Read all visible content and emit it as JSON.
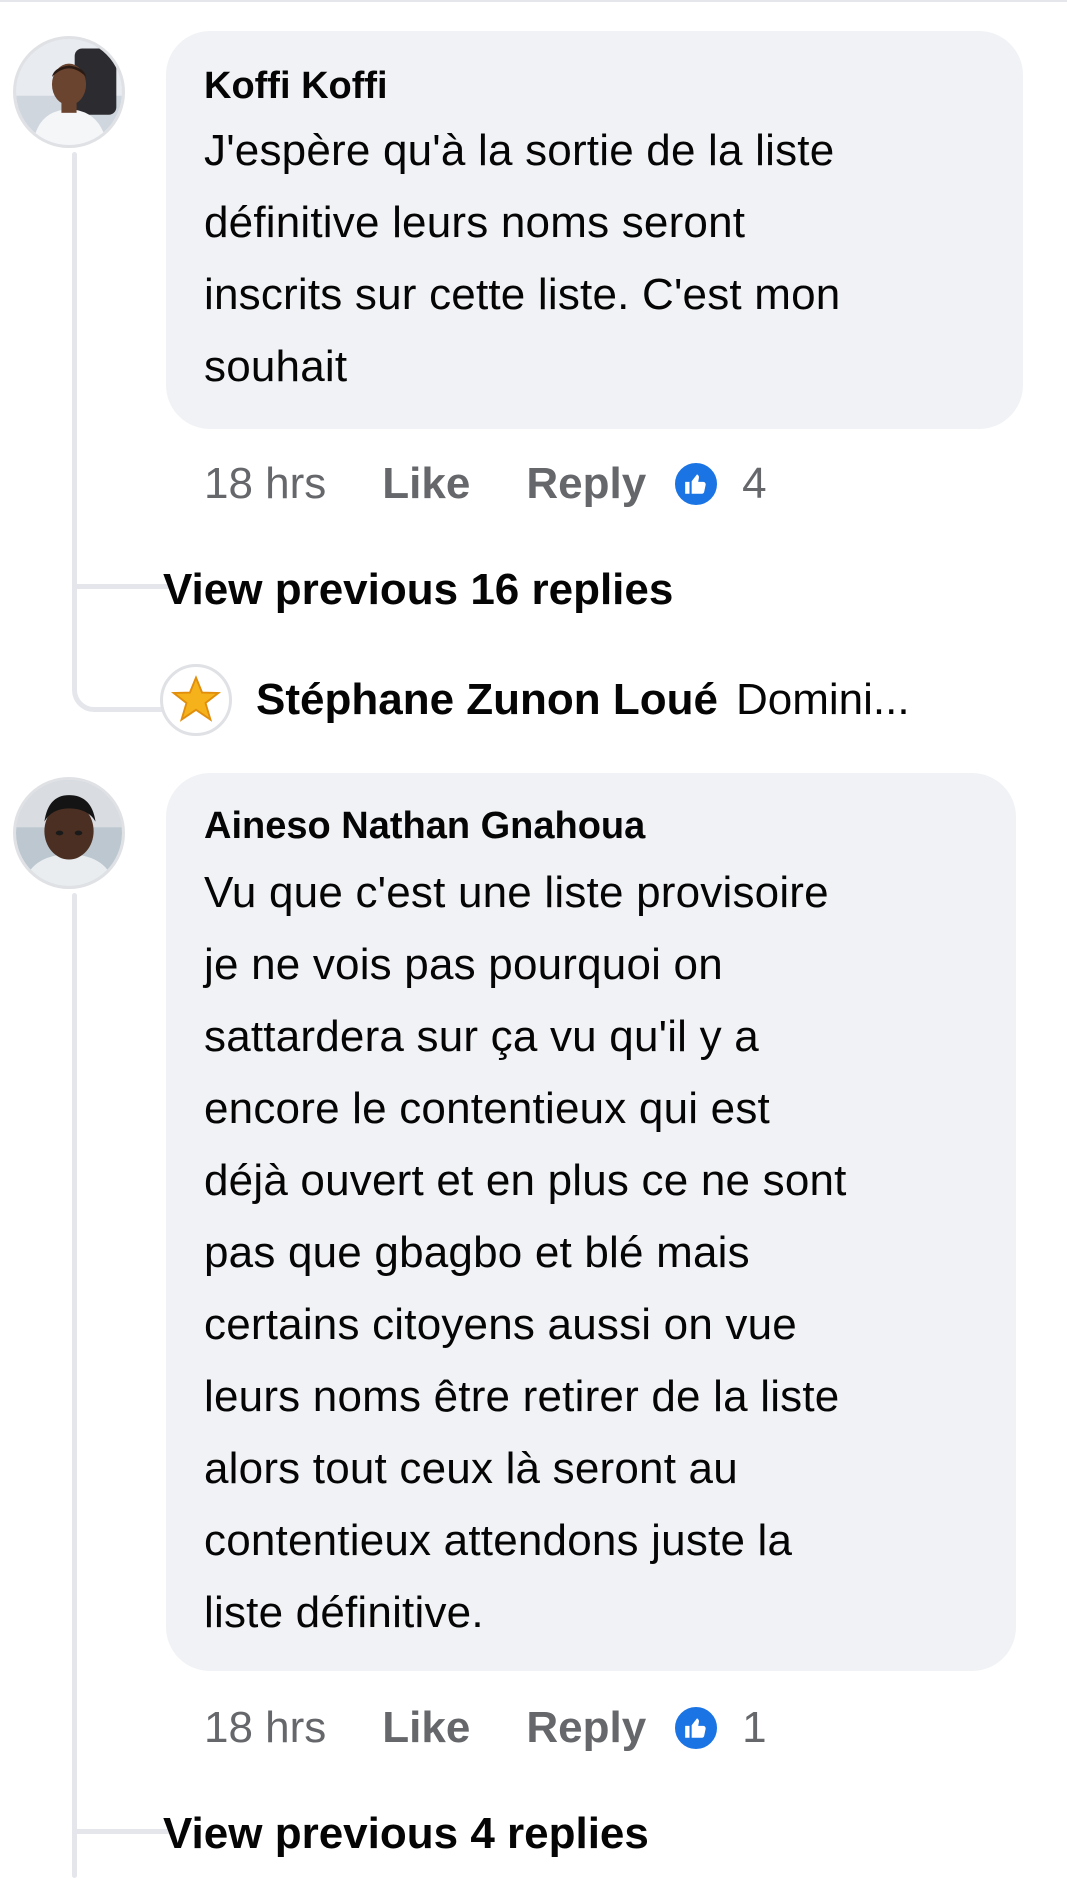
{
  "comments": [
    {
      "author": "Koffi Koffi",
      "text_lines": [
        "J'espère qu'à la sortie de la liste",
        "définitive leurs noms seront",
        "inscrits sur cette liste. C'est mon",
        "souhait"
      ],
      "time": "18 hrs",
      "like_label": "Like",
      "reply_label": "Reply",
      "reaction_count": "4",
      "view_previous": "View previous 16 replies",
      "latest_reply": {
        "author": "Stéphane Zunon Loué",
        "snippet": "Domini..."
      }
    },
    {
      "author": "Aineso Nathan Gnahoua",
      "text_lines": [
        "Vu que c'est une liste provisoire",
        "je ne vois pas pourquoi on",
        "sattardera sur ça vu qu'il y a",
        "encore le contentieux qui est",
        "déjà ouvert et en plus ce ne sont",
        "pas que gbagbo et blé mais",
        "certains citoyens aussi on vue",
        "leurs noms être retirer de la liste",
        "alors tout ceux là seront au",
        "contentieux attendons juste la",
        "liste définitive."
      ],
      "time": "18 hrs",
      "like_label": "Like",
      "reply_label": "Reply",
      "reaction_count": "1",
      "view_previous": "View previous 4 replies"
    }
  ],
  "colors": {
    "bubble": "#f0f2f5",
    "meta_text": "#65676b",
    "like_blue": "#1b74e4",
    "thread_line": "#e4e6eb"
  }
}
